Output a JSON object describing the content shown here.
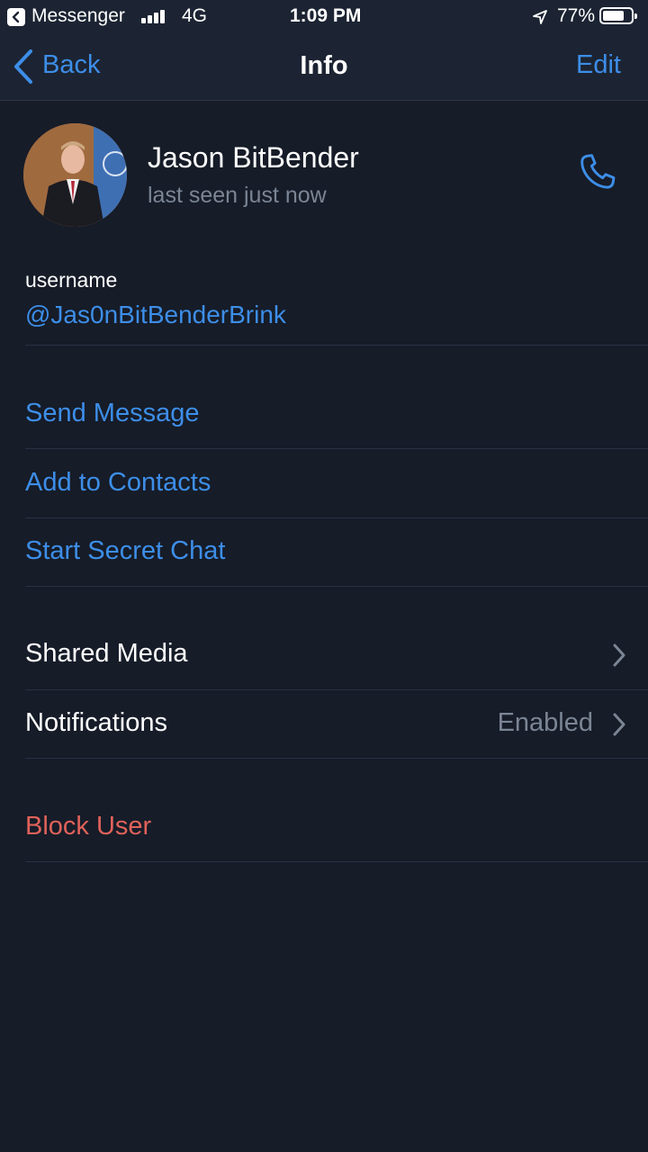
{
  "status_bar": {
    "back_app": "Messenger",
    "network": "4G",
    "time": "1:09 PM",
    "battery_percent": "77%",
    "battery_level": 0.77
  },
  "nav": {
    "back_label": "Back",
    "title": "Info",
    "edit_label": "Edit"
  },
  "profile": {
    "name": "Jason BitBender",
    "status": "last seen just now"
  },
  "username": {
    "label": "username",
    "value": "@Jas0nBitBenderBrink"
  },
  "actions": {
    "send_message": "Send Message",
    "add_to_contacts": "Add to Contacts",
    "start_secret_chat": "Start Secret Chat"
  },
  "settings": {
    "shared_media": "Shared Media",
    "notifications": "Notifications",
    "notifications_value": "Enabled"
  },
  "danger": {
    "block_user": "Block User"
  },
  "colors": {
    "background": "#161c28",
    "bar": "#1c2433",
    "accent": "#3d8ee8",
    "danger": "#e0625a",
    "secondary_text": "#7b8594"
  }
}
